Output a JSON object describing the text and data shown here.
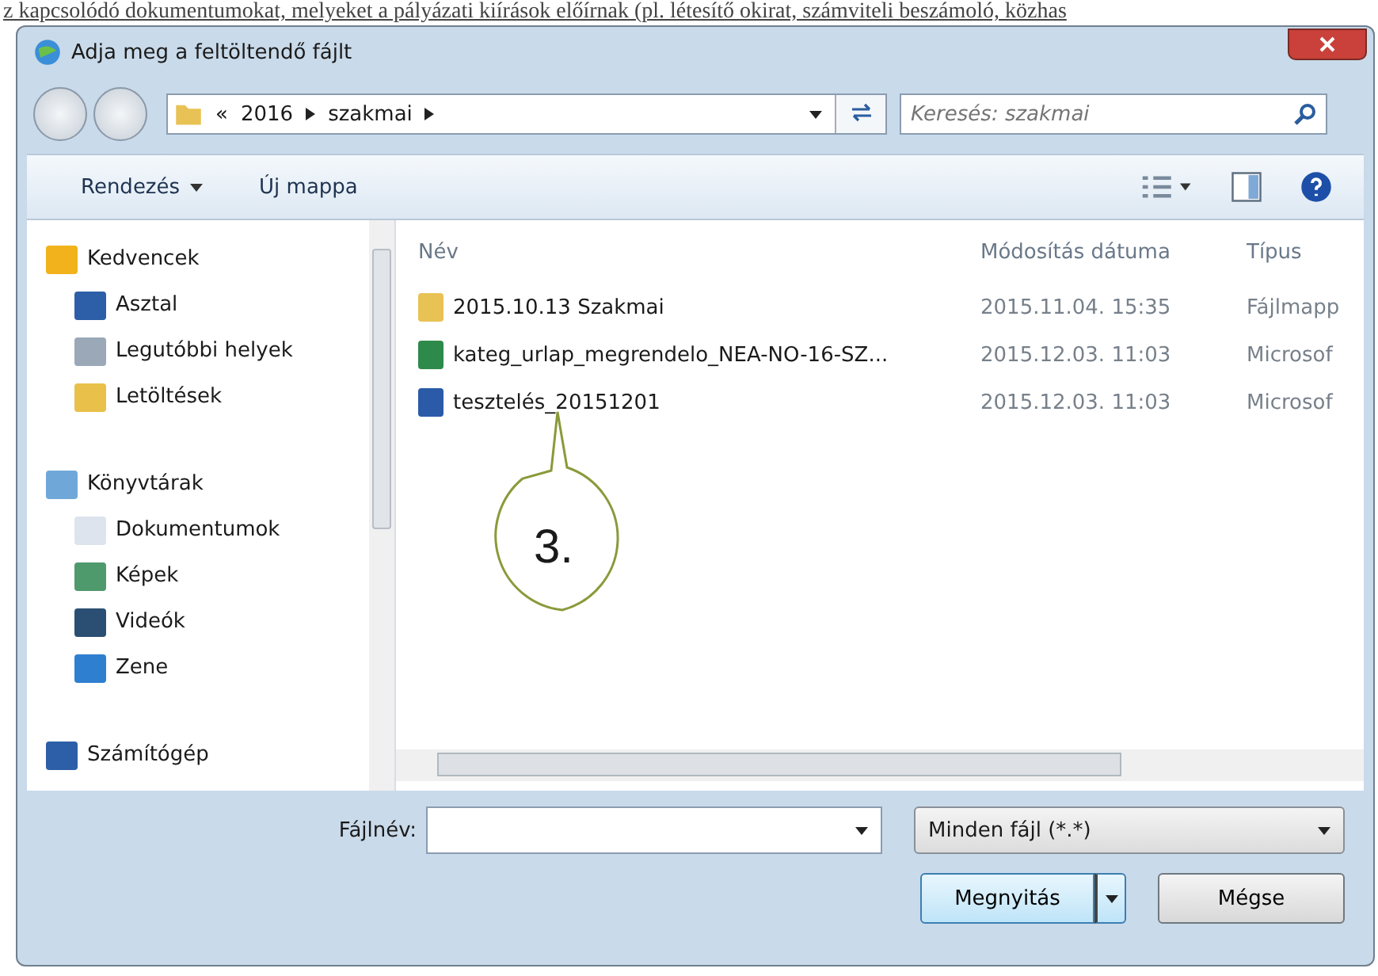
{
  "background_text": "z kapcsolódó dokumentumokat, melyeket a pályázati kiírások előírnak (pl. létesítő okirat, számviteli beszámoló, közhas",
  "window": {
    "title": "Adja meg a feltöltendő fájlt"
  },
  "address_bar": {
    "overflow": "«",
    "crumbs": [
      "2016",
      "szakmai"
    ]
  },
  "search": {
    "placeholder": "Keresés: szakmai"
  },
  "toolbar": {
    "organize": "Rendezés",
    "new_folder": "Új mappa"
  },
  "sidebar": {
    "groups": [
      {
        "label": "Kedvencek",
        "items": [
          {
            "label": "Asztal"
          },
          {
            "label": "Legutóbbi helyek"
          },
          {
            "label": "Letöltések"
          }
        ]
      },
      {
        "label": "Könyvtárak",
        "items": [
          {
            "label": "Dokumentumok"
          },
          {
            "label": "Képek"
          },
          {
            "label": "Videók"
          },
          {
            "label": "Zene"
          }
        ]
      },
      {
        "label": "Számítógép"
      }
    ]
  },
  "file_list": {
    "columns": [
      "Név",
      "Módosítás dátuma",
      "Típus"
    ],
    "rows": [
      {
        "kind": "folder",
        "name": "2015.10.13 Szakmai",
        "date": "2015.11.04. 15:35",
        "type": "Fájlmapp"
      },
      {
        "kind": "excel",
        "name": "kateg_urlap_megrendelo_NEA-NO-16-SZ...",
        "date": "2015.12.03. 11:03",
        "type": "Microsof"
      },
      {
        "kind": "word",
        "name": "tesztelés_20151201",
        "date": "2015.12.03. 11:03",
        "type": "Microsof"
      }
    ]
  },
  "callout": {
    "text": "3."
  },
  "file_name": {
    "label": "Fájlnév:"
  },
  "file_type": {
    "value": "Minden fájl (*.*)"
  },
  "buttons": {
    "open": "Megnyitás",
    "cancel": "Mégse"
  }
}
